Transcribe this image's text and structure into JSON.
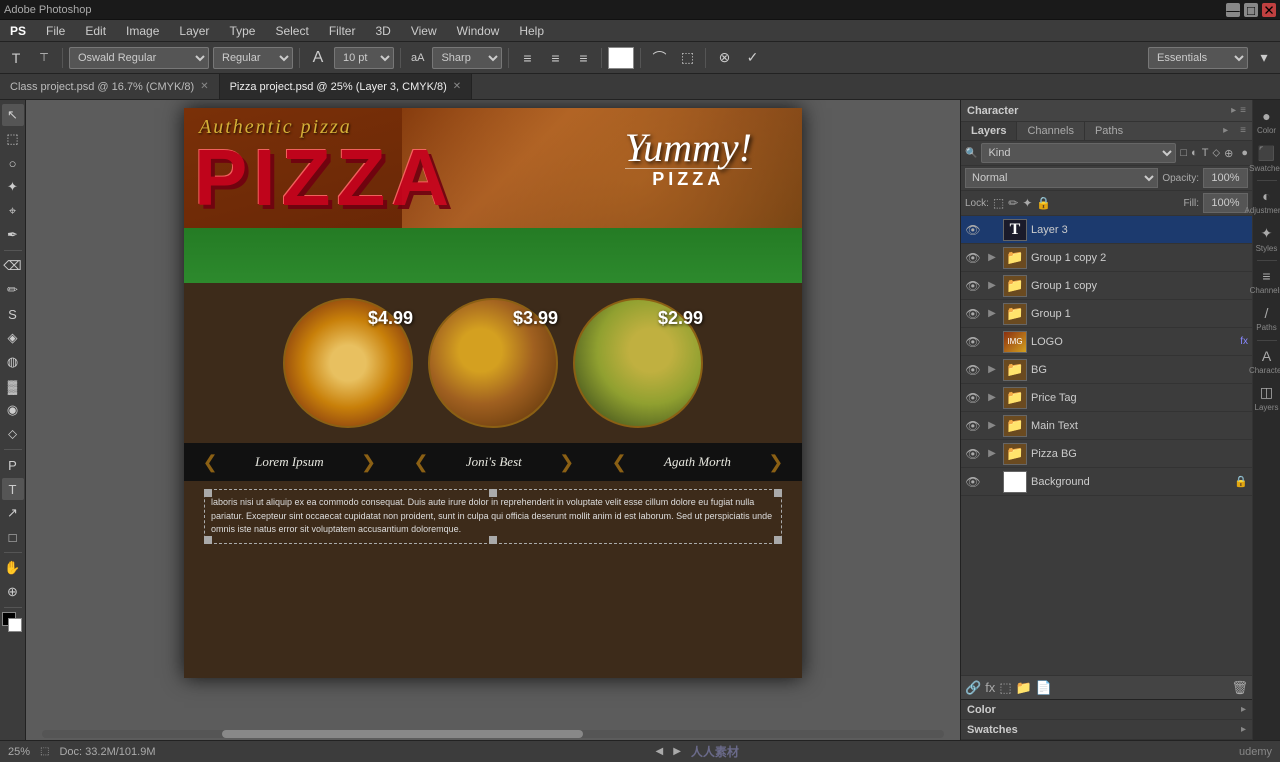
{
  "titlebar": {
    "title": "Adobe Photoshop"
  },
  "menubar": {
    "items": [
      "PS",
      "File",
      "Edit",
      "Image",
      "Layer",
      "Type",
      "Select",
      "Filter",
      "3D",
      "View",
      "Window",
      "Help"
    ]
  },
  "toolbar": {
    "font_family": "Oswald Regular",
    "font_style": "Regular",
    "font_size": "10 pt",
    "aa_method": "Sharp",
    "align_label": "",
    "color_label": "",
    "essentials_label": "Essentials",
    "mode_btn": "▾"
  },
  "tabs": [
    {
      "label": "Class project.psd @ 16.7% (CMYK/8)",
      "active": false
    },
    {
      "label": "Pizza project.psd @ 25% (Layer 3, CMYK/8)",
      "active": true
    }
  ],
  "canvas": {
    "zoom": "25%",
    "doc_info": "Doc: 33.2M/101.9M",
    "scroll_position": "20%"
  },
  "flyer": {
    "title_script": "Authentic pizza",
    "pizza_word": "PIZZA",
    "yummy_text": "Yummy!",
    "yummy_sub": "PIZZA",
    "items": [
      {
        "price": "$4.99",
        "name": "Lorem Ipsum"
      },
      {
        "price": "$3.99",
        "name": "Joni's Best"
      },
      {
        "price": "$2.99",
        "name": "Agath Morth"
      }
    ],
    "lorem_text": "laboris nisi ut aliquip ex ea commodo consequat. Duis aute irure dolor in reprehenderit in voluptate velit esse cillum dolore eu fugiat nulla pariatur. Excepteur sint occaecat cupidatat non proident, sunt in culpa qui officia deserunt mollit anim id est laborum. Sed ut perspiciatis unde omnis iste natus error sit voluptatem accusantium doloremque."
  },
  "layers_panel": {
    "title": "Layers",
    "filter_placeholder": "Kind",
    "blend_mode": "Normal",
    "opacity_label": "Opacity:",
    "opacity_value": "100%",
    "lock_label": "Lock:",
    "fill_label": "Fill:",
    "fill_value": "100%",
    "layers": [
      {
        "id": "layer3",
        "name": "Layer 3",
        "type": "text",
        "visible": true,
        "selected": true,
        "has_fx": false,
        "locked": false,
        "indent": 0
      },
      {
        "id": "group1copy2",
        "name": "Group 1 copy 2",
        "type": "folder",
        "visible": true,
        "selected": false,
        "has_fx": false,
        "locked": false,
        "indent": 0
      },
      {
        "id": "group1copy",
        "name": "Group 1 copy",
        "type": "folder",
        "visible": true,
        "selected": false,
        "has_fx": false,
        "locked": false,
        "indent": 0
      },
      {
        "id": "group1",
        "name": "Group 1",
        "type": "folder",
        "visible": true,
        "selected": false,
        "has_fx": false,
        "locked": false,
        "indent": 0
      },
      {
        "id": "logo",
        "name": "LOGO",
        "type": "image",
        "visible": true,
        "selected": false,
        "has_fx": true,
        "locked": false,
        "indent": 0
      },
      {
        "id": "bg",
        "name": "BG",
        "type": "folder",
        "visible": true,
        "selected": false,
        "has_fx": false,
        "locked": false,
        "indent": 0
      },
      {
        "id": "pricetag",
        "name": "Price Tag",
        "type": "folder",
        "visible": true,
        "selected": false,
        "has_fx": false,
        "locked": false,
        "indent": 0
      },
      {
        "id": "maintext",
        "name": "Main Text",
        "type": "folder",
        "visible": true,
        "selected": false,
        "has_fx": false,
        "locked": false,
        "indent": 0
      },
      {
        "id": "pizzabg",
        "name": "Pizza BG",
        "type": "folder",
        "visible": true,
        "selected": false,
        "has_fx": false,
        "locked": false,
        "indent": 0
      },
      {
        "id": "background",
        "name": "Background",
        "type": "white",
        "visible": true,
        "selected": false,
        "has_fx": false,
        "locked": true,
        "indent": 0
      }
    ]
  },
  "character_panel": {
    "title": "Character"
  },
  "right_panel_icons": [
    {
      "icon": "●",
      "label": "Color"
    },
    {
      "icon": "⬛",
      "label": "Swatches"
    },
    {
      "icon": "◐",
      "label": "Adjust"
    },
    {
      "icon": "✦",
      "label": "Styles"
    },
    {
      "icon": "≡",
      "label": "Channels"
    },
    {
      "icon": "/",
      "label": "Paths"
    },
    {
      "icon": "A",
      "label": "Character"
    },
    {
      "icon": "◫",
      "label": "Layers"
    }
  ],
  "toolbox": {
    "tools": [
      {
        "icon": "↖",
        "name": "move-tool"
      },
      {
        "icon": "⬚",
        "name": "marquee-tool"
      },
      {
        "icon": "⊗",
        "name": "lasso-tool"
      },
      {
        "icon": "✦",
        "name": "quick-select-tool"
      },
      {
        "icon": "✂",
        "name": "crop-tool"
      },
      {
        "icon": "⚗",
        "name": "eyedropper-tool"
      },
      {
        "icon": "⌫",
        "name": "healing-tool"
      },
      {
        "icon": "✏",
        "name": "brush-tool"
      },
      {
        "icon": "S",
        "name": "clone-stamp-tool"
      },
      {
        "icon": "◈",
        "name": "history-brush-tool"
      },
      {
        "icon": "◍",
        "name": "eraser-tool"
      },
      {
        "icon": "▓",
        "name": "gradient-tool"
      },
      {
        "icon": "◉",
        "name": "blur-tool"
      },
      {
        "icon": "⬦",
        "name": "dodge-tool"
      },
      {
        "icon": "P",
        "name": "pen-tool"
      },
      {
        "icon": "T",
        "name": "text-tool",
        "active": true
      },
      {
        "icon": "↗",
        "name": "path-select-tool"
      },
      {
        "icon": "□",
        "name": "shape-tool"
      },
      {
        "icon": "✋",
        "name": "hand-tool"
      },
      {
        "icon": "⊕",
        "name": "zoom-tool"
      }
    ],
    "fg_color": "#000000",
    "bg_color": "#ffffff"
  },
  "statusbar": {
    "zoom": "25%",
    "doc_info": "Doc: 33.2M/101.9M",
    "watermark": "人人素材",
    "brand": "udemy"
  }
}
